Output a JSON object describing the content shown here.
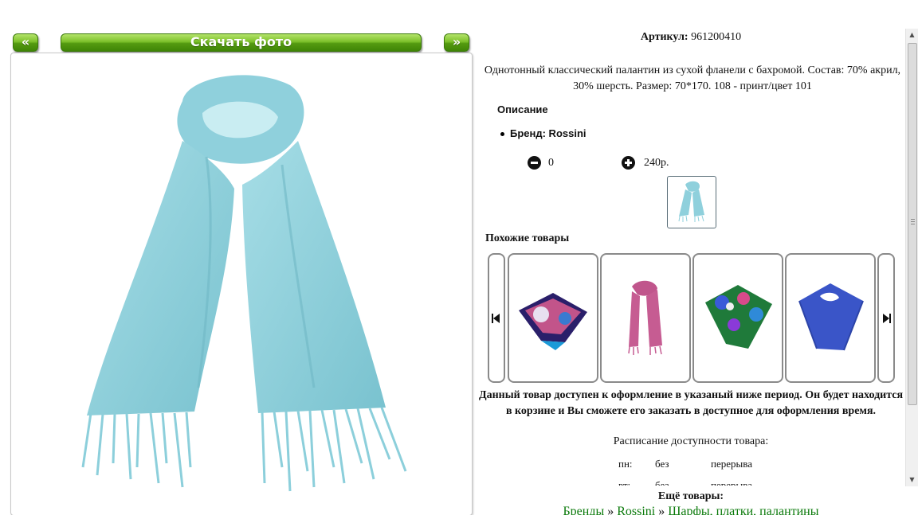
{
  "viewer": {
    "prev_label": "«",
    "download_label": "Скачать фото",
    "next_label": "»",
    "accent_color": "#6cb51e"
  },
  "product": {
    "sku_label": "Артикул:",
    "sku_value": "961200410",
    "description": "Однотонный классический палантин из сухой фланели с бахромой. Состав: 70% акрил, 30% шерсть. Размер: 70*170. 108 - принт/цвет 101",
    "description_heading": "Описание",
    "brand_line": "Бренд: Rossini",
    "quantity": "0",
    "price": "240р.",
    "minus_icon": "minus-circle-icon",
    "plus_icon": "plus-circle-icon"
  },
  "similar": {
    "title": "Похожие товары",
    "items": [
      {
        "name": "printed-silk-scarf",
        "color": "#3b2a7a"
      },
      {
        "name": "pink-scarf",
        "color": "#c0558c"
      },
      {
        "name": "green-floral-scarf",
        "color": "#2e7a3a"
      },
      {
        "name": "blue-scarf",
        "color": "#3a55c8"
      }
    ]
  },
  "availability": {
    "notice": "Данный товар доступен к оформление в указаный ниже период. Он будет находится в корзине и Вы сможете его заказать в доступное для оформления время.",
    "schedule_title": "Расписание доступности товара:",
    "rows": [
      {
        "day": "пн:",
        "a": "без",
        "b": "перерыва"
      },
      {
        "day": "вт:",
        "a": "без",
        "b": "перерыва"
      }
    ]
  },
  "more": {
    "title": "Ещё товары:",
    "crumbs": [
      "Бренды",
      "Rossini",
      "Шарфы, платки, палантины"
    ],
    "sep": "»"
  }
}
